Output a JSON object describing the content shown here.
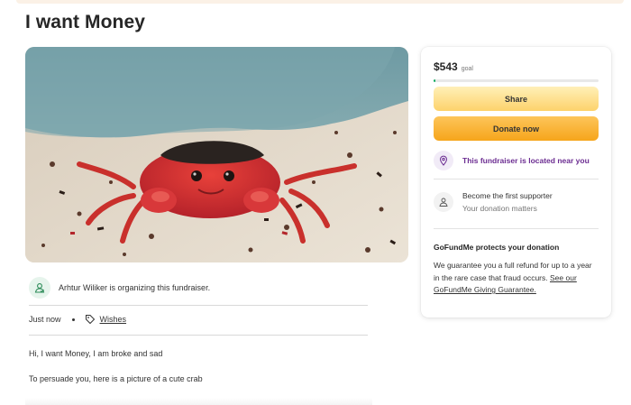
{
  "page": {
    "title": "I want Money"
  },
  "organizer": {
    "text": "Arhtur Wiliker is organizing this fundraiser.",
    "icon": "organizer-icon"
  },
  "meta": {
    "posted": "Just now",
    "category": "Wishes",
    "category_icon": "tag-icon"
  },
  "story": {
    "paragraphs": [
      "Hi, I want Money, I am broke and sad",
      "To persuade you, here is a picture of a cute crab"
    ]
  },
  "donation_card": {
    "amount_raised": "$543",
    "goal_label": "goal",
    "progress_fraction": 0.01,
    "colors": {
      "progress": "#02a95c",
      "share_button": "#fdd26b",
      "donate_button": "#f6a51b",
      "nearby_text": "#6b2c91"
    },
    "share_label": "Share",
    "donate_label": "Donate now",
    "nearby_text": "This fundraiser is located near you",
    "nearby_icon": "location-pin-icon",
    "supporter_title": "Become the first supporter",
    "supporter_subtitle": "Your donation matters",
    "supporter_icon": "supporter-icon",
    "protection_title": "GoFundMe protects your donation",
    "protection_body": "We guarantee you a full refund for up to a year in the rare case that fraud occurs.",
    "protection_link": "See our GoFundMe Giving Guarantee."
  }
}
